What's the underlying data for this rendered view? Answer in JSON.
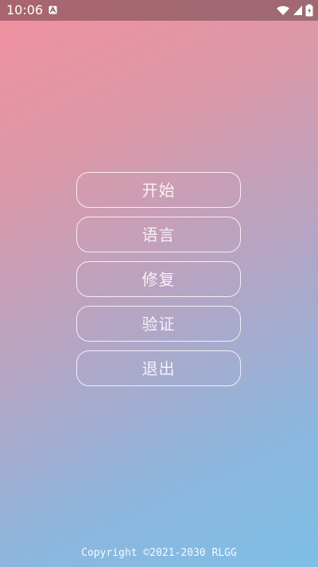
{
  "status_bar": {
    "time": "10:06",
    "icons": [
      "android-notification-icon",
      "wifi-icon",
      "signal-icon",
      "battery-icon"
    ]
  },
  "menu": {
    "items": [
      {
        "label": "开始"
      },
      {
        "label": "语言"
      },
      {
        "label": "修复"
      },
      {
        "label": "验证"
      },
      {
        "label": "退出"
      }
    ]
  },
  "footer": {
    "text": "Copyright ©2021-2030 RLGG"
  },
  "colors": {
    "gradient_top_left": "#f2909d",
    "gradient_bottom_right": "#7fbee6",
    "button_border": "#ffffff",
    "text": "#ffffff"
  }
}
